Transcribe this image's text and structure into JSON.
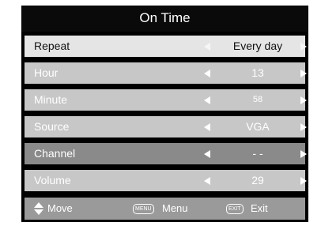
{
  "header": {
    "title": "On Time"
  },
  "rows": [
    {
      "label": "Repeat",
      "value": "Every day",
      "state": "selected"
    },
    {
      "label": "Hour",
      "value": "13",
      "state": "normal"
    },
    {
      "label": "Minute",
      "value": "58",
      "state": "normal"
    },
    {
      "label": "Source",
      "value": "VGA",
      "state": "normal"
    },
    {
      "label": "Channel",
      "value": "- -",
      "state": "dark"
    },
    {
      "label": "Volume",
      "value": "29",
      "state": "normal"
    }
  ],
  "footer": {
    "move_label": "Move",
    "menu_key": "MENU",
    "menu_label": "Menu",
    "exit_key": "EXIT",
    "exit_label": "Exit"
  },
  "colors": {
    "background": "#000000",
    "selected_row": "#e5e5e5",
    "normal_row": "#c7c7c7",
    "dark_row": "#8a8a8a",
    "footer": "#9a9a9a"
  },
  "icons": {
    "nav_left": "triangle-left-icon",
    "nav_right": "triangle-right-icon",
    "move": "up-down-arrows-icon",
    "menu": "menu-key-icon",
    "exit": "exit-key-icon"
  }
}
